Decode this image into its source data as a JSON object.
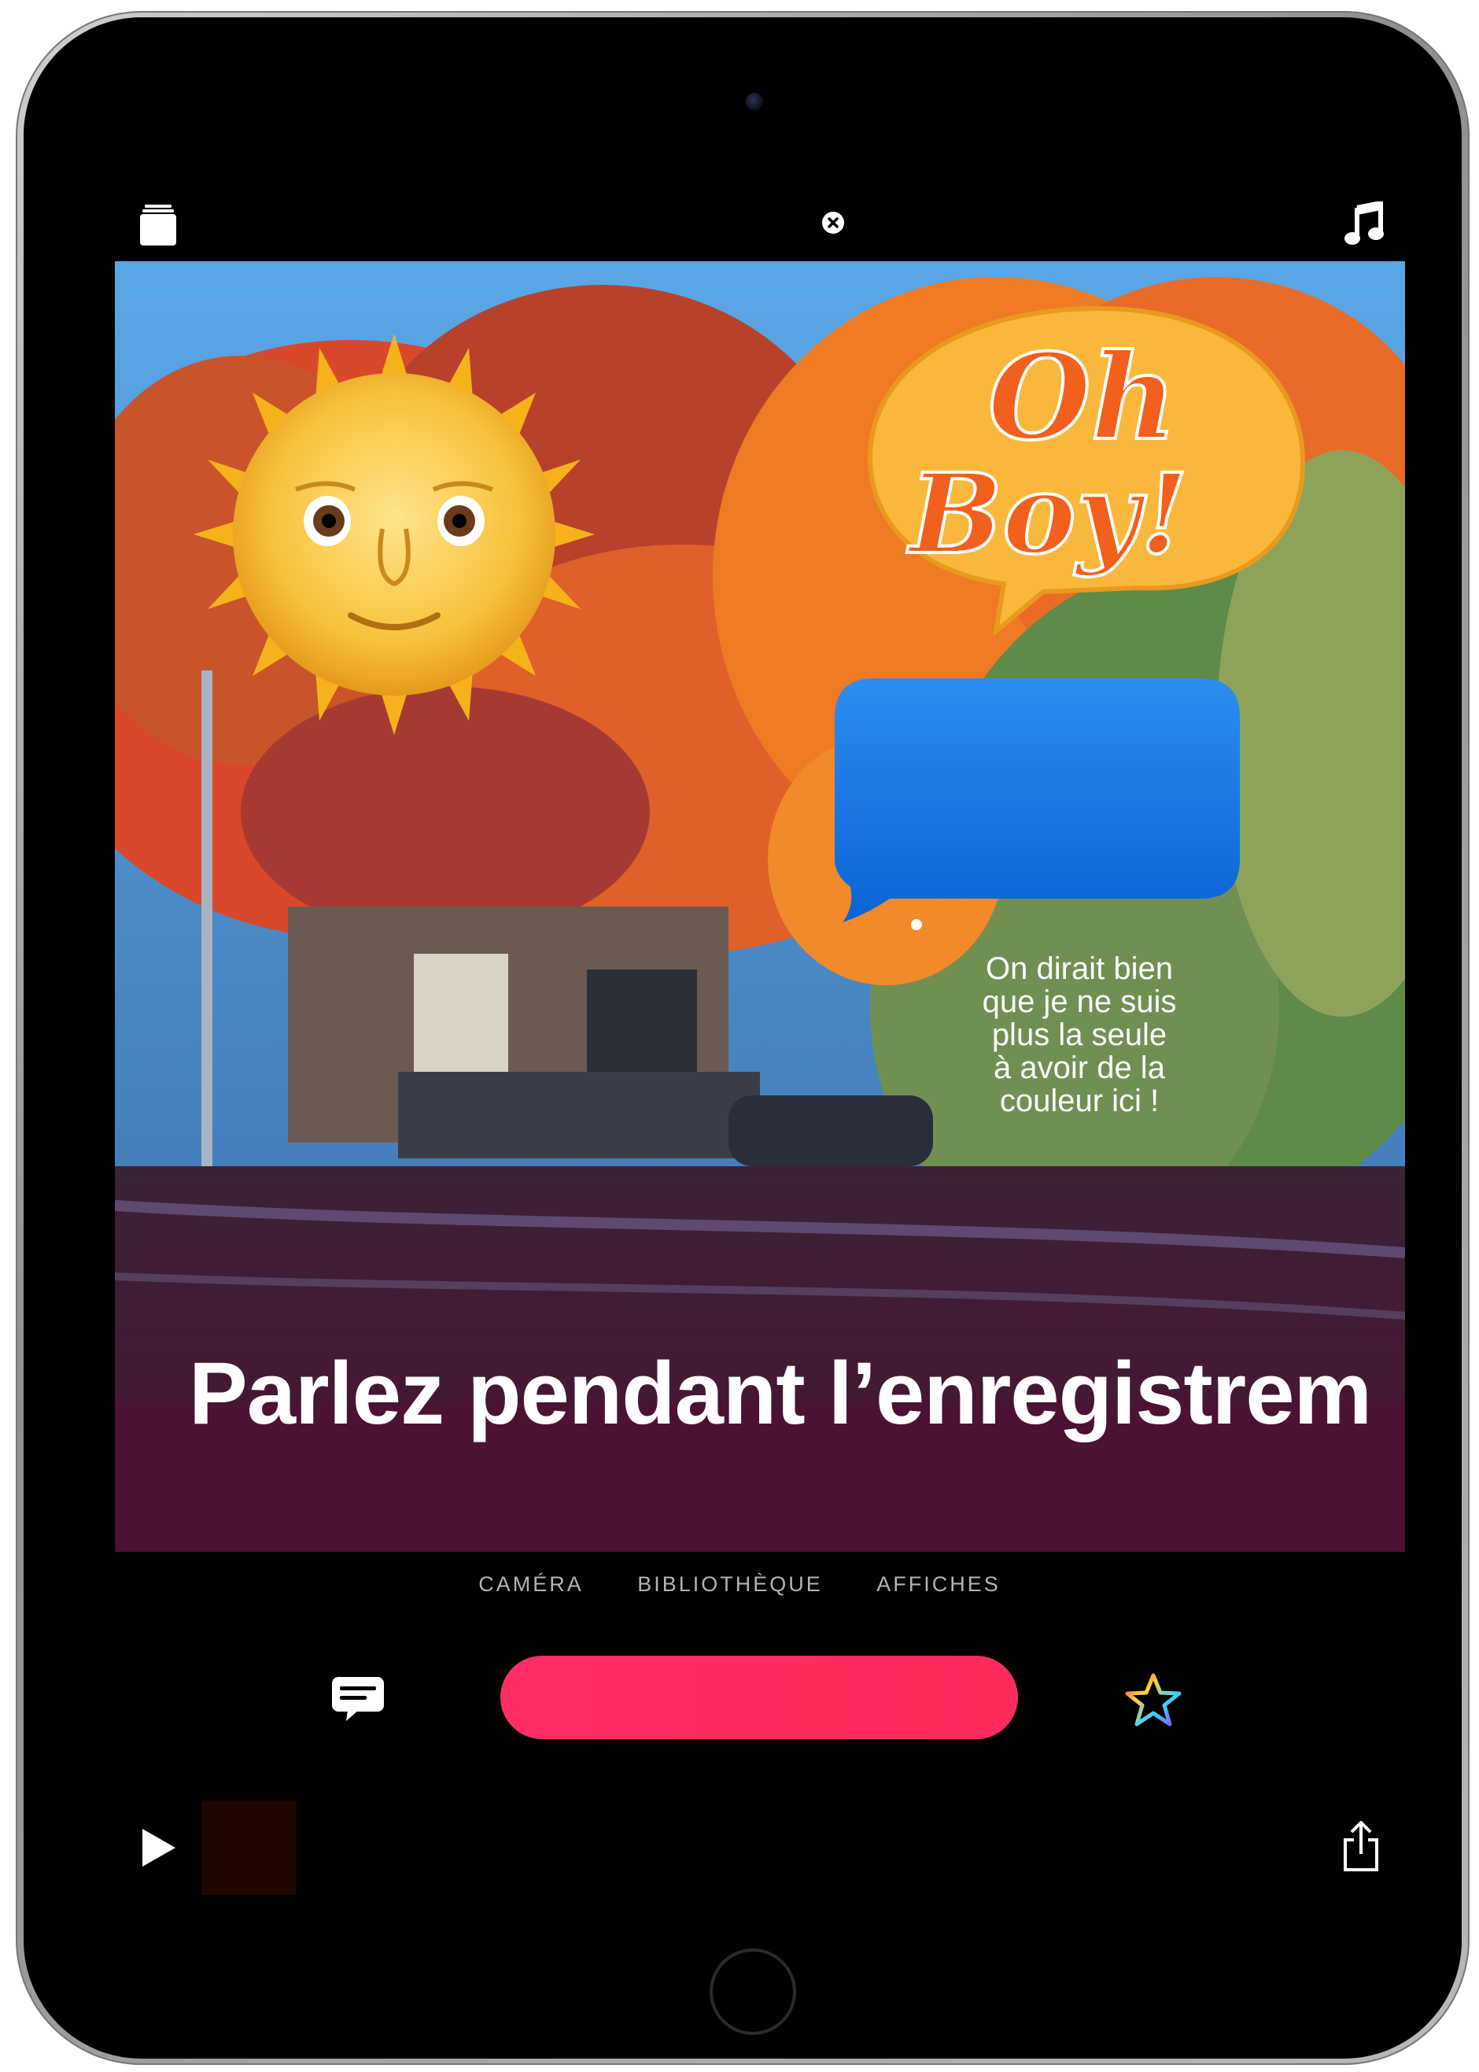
{
  "topbar": {
    "projects_icon": "projects-stack-icon",
    "close_icon": "close-circle-icon",
    "music_icon": "music-note-icon"
  },
  "stage": {
    "caption": "Parlez pendant l’enregistrem",
    "sticker_sun": "sun-with-face-sticker",
    "sticker_oh_boy": "Oh Boy!",
    "bubble_text": [
      "On dirait bien",
      "que je ne suis",
      "plus la seule",
      "à avoir de la",
      "couleur ici !"
    ]
  },
  "tabs": [
    "CAMÉRA",
    "BIBLIOTHÈQUE",
    "AFFICHES"
  ],
  "controls": {
    "captions_icon": "speech-bubble-icon",
    "effects_icon": "star-icon",
    "record_color": "#ff2a5e"
  },
  "bottom": {
    "play_icon": "play-icon",
    "share_icon": "share-icon"
  }
}
